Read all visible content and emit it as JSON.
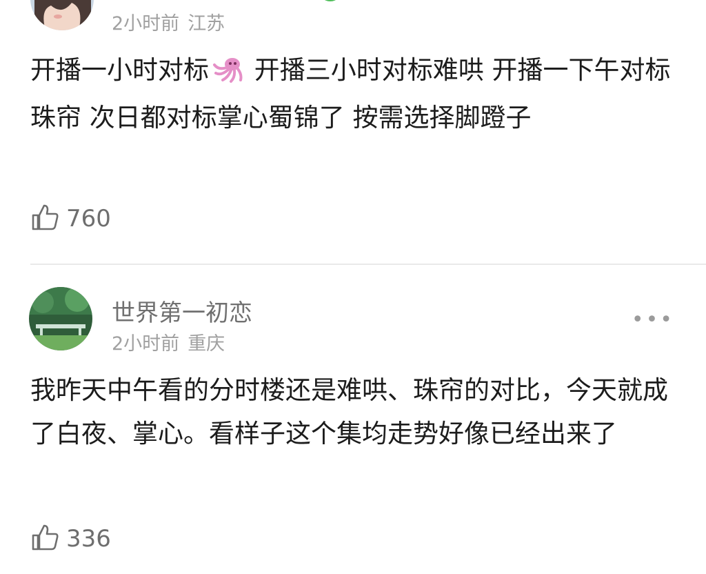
{
  "comments": [
    {
      "author": "",
      "time": "2小时前",
      "location": "江苏",
      "text_before_emoji": "开播一小时对标",
      "emoji": "squid",
      "text_after_emoji": " 开播三小时对标难哄 开播一下午对标珠帘 次日都对标掌心蜀锦了 按需选择脚蹬子",
      "likes": "760"
    },
    {
      "author": "世界第一初恋",
      "time": "2小时前",
      "location": "重庆",
      "text": "我昨天中午看的分时楼还是难哄、珠帘的对比，今天就成了白夜、掌心。看样子这个集均走势好像已经出来了",
      "likes": "336"
    }
  ],
  "icons": {
    "like": "thumbs-up-icon",
    "more": "more-icon",
    "emoji": "squid-icon"
  },
  "colors": {
    "text": "#1c1c1c",
    "author": "#707070",
    "meta": "#a0a0a0",
    "divider": "#e9e9e9"
  }
}
